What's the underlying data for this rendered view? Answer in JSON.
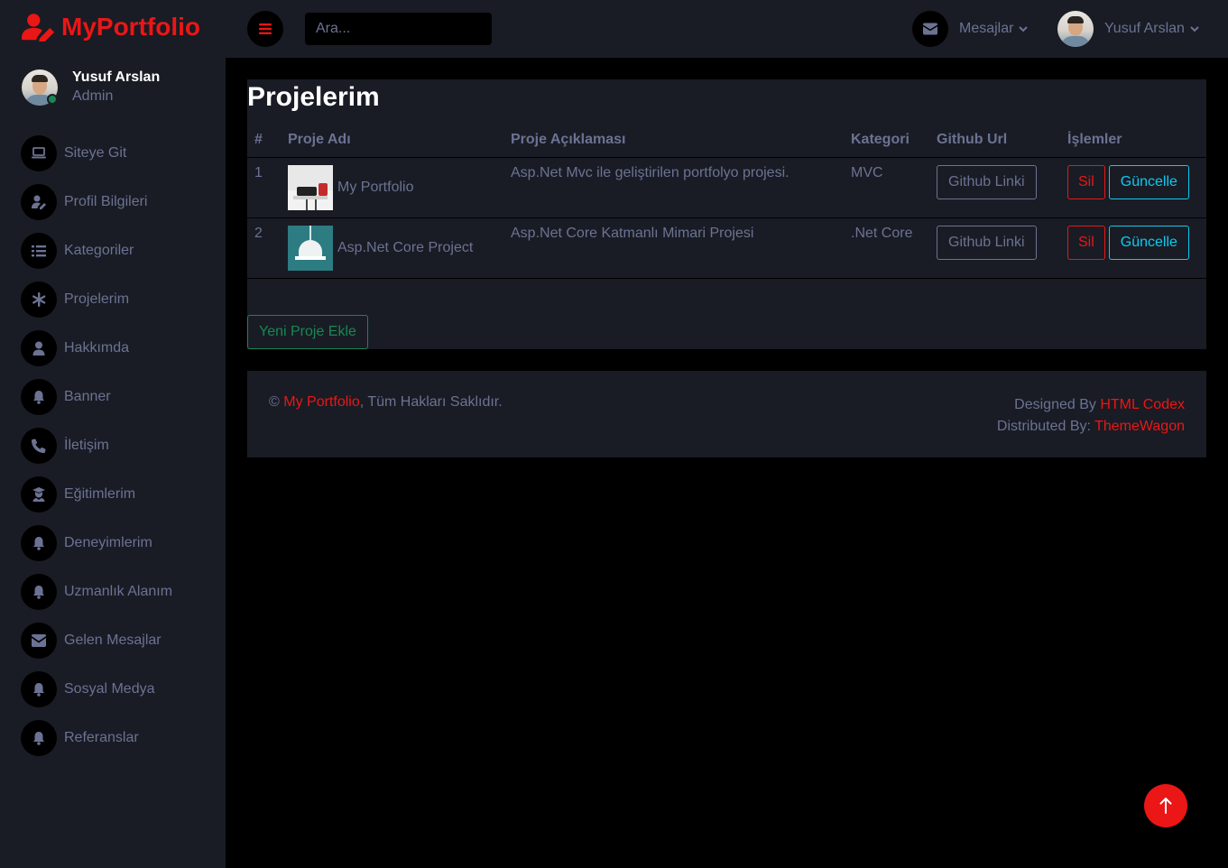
{
  "brand": {
    "name": "MyPortfolio"
  },
  "sidebar": {
    "profile": {
      "name": "Yusuf Arslan",
      "role": "Admin"
    },
    "items": [
      {
        "label": "Siteye Git",
        "icon": "laptop-icon"
      },
      {
        "label": "Profil Bilgileri",
        "icon": "user-edit-icon"
      },
      {
        "label": "Kategoriler",
        "icon": "list-icon"
      },
      {
        "label": "Projelerim",
        "icon": "asterisk-icon"
      },
      {
        "label": "Hakkımda",
        "icon": "user-icon"
      },
      {
        "label": "Banner",
        "icon": "bell-icon"
      },
      {
        "label": "İletişim",
        "icon": "phone-icon"
      },
      {
        "label": "Eğitimlerim",
        "icon": "graduate-icon"
      },
      {
        "label": "Deneyimlerim",
        "icon": "bell-icon"
      },
      {
        "label": "Uzmanlık Alanım",
        "icon": "bell-icon"
      },
      {
        "label": "Gelen Mesajlar",
        "icon": "envelope-icon"
      },
      {
        "label": "Sosyal Medya",
        "icon": "bell-icon"
      },
      {
        "label": "Referanslar",
        "icon": "bell-icon"
      }
    ]
  },
  "topbar": {
    "search_placeholder": "Ara...",
    "messages_label": "Mesajlar",
    "user_name": "Yusuf Arslan"
  },
  "main": {
    "title": "Projelerim",
    "columns": [
      "#",
      "Proje Adı",
      "Proje Açıklaması",
      "Kategori",
      "Github Url",
      "İşlemler"
    ],
    "rows": [
      {
        "index": "1",
        "name": "My Portfolio",
        "description": "Asp.Net Mvc ile geliştirilen portfolyo projesi.",
        "category": "MVC",
        "github_label": "Github Linki",
        "delete_label": "Sil",
        "update_label": "Güncelle"
      },
      {
        "index": "2",
        "name": "Asp.Net Core Project",
        "description": "Asp.Net Core Katmanlı Mimari Projesi",
        "category": ".Net Core",
        "github_label": "Github Linki",
        "delete_label": "Sil",
        "update_label": "Güncelle"
      }
    ],
    "add_button": "Yeni Proje Ekle"
  },
  "footer": {
    "copyright_symbol": "©",
    "site_link": "My Portfolio",
    "rights": ", Tüm Hakları Saklıdır.",
    "designed_by": "Designed By",
    "designer_link": "HTML Codex",
    "distributed_by": "Distributed By:",
    "distributor_link": "ThemeWagon"
  },
  "colors": {
    "accent": "#EB1616",
    "sidebar_bg": "#191C24",
    "page_bg": "#000000",
    "text_muted": "#6C7293",
    "info": "#0DCAF0",
    "success": "#198754"
  }
}
